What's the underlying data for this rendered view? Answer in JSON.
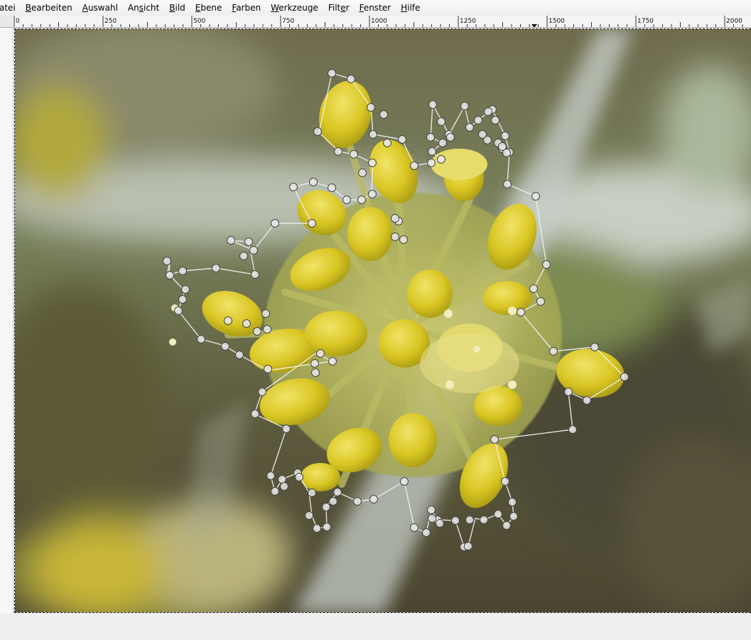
{
  "menu": {
    "items": [
      {
        "label": "atei",
        "mnemonic_index": -1
      },
      {
        "label": "Bearbeiten",
        "mnemonic_index": 0
      },
      {
        "label": "Auswahl",
        "mnemonic_index": 0
      },
      {
        "label": "Ansicht",
        "mnemonic_index": 2
      },
      {
        "label": "Bild",
        "mnemonic_index": 0
      },
      {
        "label": "Ebene",
        "mnemonic_index": 0
      },
      {
        "label": "Farben",
        "mnemonic_index": 0
      },
      {
        "label": "Werkzeuge",
        "mnemonic_index": 0
      },
      {
        "label": "Filter",
        "mnemonic_index": 4
      },
      {
        "label": "Fenster",
        "mnemonic_index": 0
      },
      {
        "label": "Hilfe",
        "mnemonic_index": 0
      }
    ]
  },
  "ruler": {
    "labels": [
      "0",
      "250",
      "500",
      "750",
      "1000",
      "1250",
      "1500",
      "1750",
      "2000"
    ],
    "marker_icon": "triangle-down-icon"
  },
  "colors": {
    "selection_outline": "#f2f2f2",
    "anchor_fill": "#e8e8e8",
    "petal_yellow": "#d8c62a",
    "background_dark": "#4e4a34",
    "background_green": "#6e7a4a"
  },
  "image": {
    "subject": "yellow flower cluster with path anchor points"
  }
}
